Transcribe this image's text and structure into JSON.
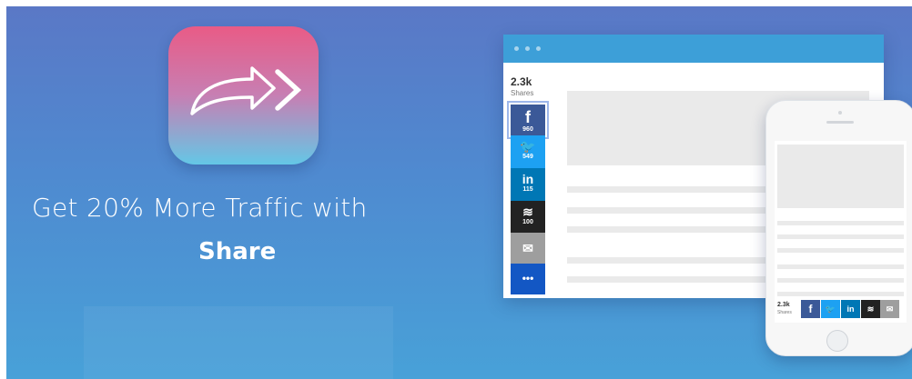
{
  "headline": {
    "line1": "Get 20% More Traffic with",
    "brand": "Share"
  },
  "app_icon": {
    "name": "share-arrows-icon"
  },
  "desktop_mock": {
    "total_count": "2.3k",
    "total_label": "Shares",
    "buttons": [
      {
        "network": "facebook",
        "glyph": "f",
        "count": "960",
        "color": "#3b5998"
      },
      {
        "network": "twitter",
        "glyph": "🐦",
        "count": "549",
        "color": "#1da1f2"
      },
      {
        "network": "linkedin",
        "glyph": "in",
        "count": "115",
        "color": "#0077b5"
      },
      {
        "network": "buffer",
        "glyph": "≋",
        "count": "100",
        "color": "#222222"
      },
      {
        "network": "email",
        "glyph": "✉",
        "count": "",
        "color": "#9e9e9e"
      },
      {
        "network": "more",
        "glyph": "•••",
        "count": "",
        "color": "#1357c4"
      }
    ]
  },
  "mobile_mock": {
    "total_count": "2.3k",
    "total_label": "Shares",
    "buttons": [
      {
        "network": "facebook",
        "glyph": "f",
        "color": "#3b5998"
      },
      {
        "network": "twitter",
        "glyph": "🐦",
        "color": "#1da1f2"
      },
      {
        "network": "linkedin",
        "glyph": "in",
        "color": "#0077b5"
      },
      {
        "network": "buffer",
        "glyph": "≋",
        "color": "#222222"
      },
      {
        "network": "email",
        "glyph": "✉",
        "color": "#9e9e9e"
      }
    ]
  },
  "colors": {
    "background_top": "#5a78c6",
    "background_bottom": "#48a1d8",
    "icon_top": "#e95b86",
    "icon_bottom": "#64c7e6",
    "browser_bar": "#3d9fd8"
  }
}
